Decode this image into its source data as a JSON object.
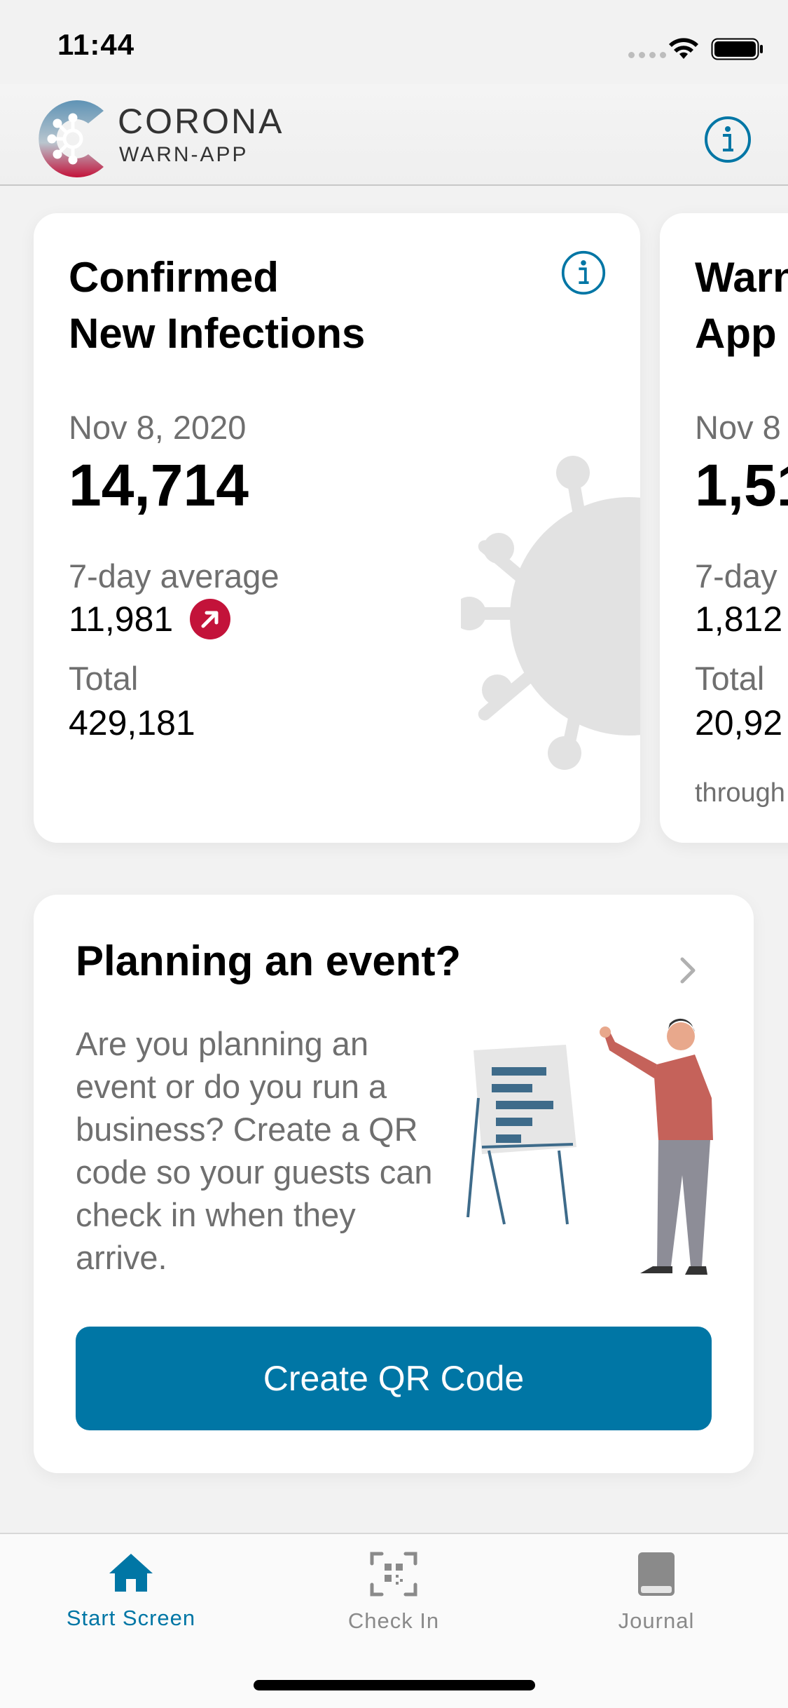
{
  "status_bar": {
    "time": "11:44"
  },
  "header": {
    "brand_name": "CORONA",
    "brand_sub": "WARN-APP"
  },
  "stats": [
    {
      "title_line1": "Confirmed",
      "title_line2": "New Infections",
      "date": "Nov 8, 2020",
      "value": "14,714",
      "avg_label": "7-day average",
      "avg_value": "11,981",
      "trend": "up",
      "total_label": "Total",
      "total_value": "429,181"
    },
    {
      "title_line1": "Warn",
      "title_line2": "App",
      "date": "Nov 8",
      "value": "1,51",
      "avg_label": "7-day",
      "avg_value": "1,812",
      "total_label": "Total",
      "total_value": "20,92",
      "footnote": "through"
    }
  ],
  "event_card": {
    "title": "Planning an event?",
    "description": "Are you planning an event or do you run a business? Create a QR code so your guests can check in when they arrive.",
    "button_label": "Create QR Code"
  },
  "tabbar": {
    "items": [
      {
        "label": "Start Screen",
        "icon": "home-icon",
        "active": true
      },
      {
        "label": "Check In",
        "icon": "qr-scan-icon",
        "active": false
      },
      {
        "label": "Journal",
        "icon": "journal-icon",
        "active": false
      }
    ]
  },
  "colors": {
    "accent": "#0076a5",
    "trend_up": "#c3133a",
    "background": "#f2f2f2",
    "secondary_text": "#6f6f6f"
  }
}
